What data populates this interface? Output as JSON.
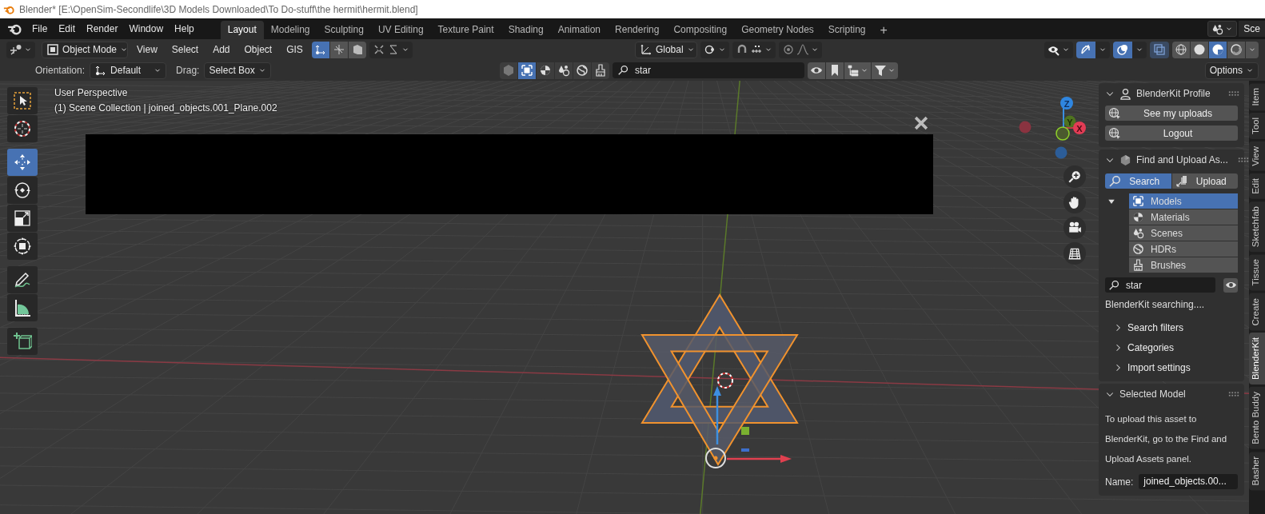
{
  "window": {
    "title": "Blender* [E:\\OpenSim-Secondlife\\3D Models Downloaded\\To Do-stuff\\the hermit\\hermit.blend]"
  },
  "menu": [
    "File",
    "Edit",
    "Render",
    "Window",
    "Help"
  ],
  "workspaces": [
    {
      "label": "Layout",
      "selected": true
    },
    {
      "label": "Modeling",
      "selected": false
    },
    {
      "label": "Sculpting",
      "selected": false
    },
    {
      "label": "UV Editing",
      "selected": false
    },
    {
      "label": "Texture Paint",
      "selected": false
    },
    {
      "label": "Shading",
      "selected": false
    },
    {
      "label": "Animation",
      "selected": false
    },
    {
      "label": "Rendering",
      "selected": false
    },
    {
      "label": "Compositing",
      "selected": false
    },
    {
      "label": "Geometry Nodes",
      "selected": false
    },
    {
      "label": "Scripting",
      "selected": false
    }
  ],
  "add_workspace": "+",
  "scene": {
    "label": "Sce"
  },
  "header": {
    "mode": "Object Mode",
    "menus": [
      "View",
      "Select",
      "Add",
      "Object",
      "GIS"
    ],
    "affect_toggles": [
      {
        "selected": true
      },
      {
        "selected": false
      },
      {
        "selected": false
      }
    ],
    "orientation": "Global",
    "gizmos_on": true,
    "overlays_on": true,
    "shading": [
      {
        "selected": false
      },
      {
        "selected": false
      },
      {
        "selected": true
      },
      {
        "selected": false
      }
    ]
  },
  "tool_settings": {
    "orientation_label": "Orientation:",
    "orientation": "Default",
    "drag_label": "Drag:",
    "drag": "Select Box",
    "asset_types": [
      {
        "kind": "any",
        "selected": false
      },
      {
        "kind": "model",
        "selected": true
      },
      {
        "kind": "material",
        "selected": false
      },
      {
        "kind": "scene",
        "selected": false
      },
      {
        "kind": "hdr",
        "selected": false
      },
      {
        "kind": "brush",
        "selected": false
      }
    ],
    "search": "star",
    "options": "Options"
  },
  "viewport": {
    "view_name": "User Perspective",
    "collection": "(1) Scene Collection | joined_objects.001_Plane.002",
    "tools": [
      {
        "kind": "select",
        "selected": false
      },
      {
        "kind": "cursor",
        "selected": false
      },
      {
        "kind": "move",
        "selected": true
      },
      {
        "kind": "rotate",
        "selected": false
      },
      {
        "kind": "scale",
        "selected": false
      },
      {
        "kind": "transform",
        "selected": false
      },
      {
        "kind": "annotate",
        "selected": false
      },
      {
        "kind": "measure",
        "selected": false
      },
      {
        "kind": "add-cube",
        "selected": false
      }
    ],
    "gizmo_axes": [
      "X",
      "Y",
      "Z"
    ]
  },
  "sidebar": {
    "profile": {
      "title": "BlenderKit Profile",
      "expanded": true,
      "buttons": [
        "See my uploads",
        "Logout"
      ]
    },
    "find": {
      "title": "Find and Upload As...",
      "expanded": true,
      "modes": [
        {
          "label": "Search",
          "selected": true
        },
        {
          "label": "Upload",
          "selected": false
        }
      ],
      "asset_types": [
        {
          "label": "Models",
          "kind": "model",
          "selected": true
        },
        {
          "label": "Materials",
          "kind": "material",
          "selected": false
        },
        {
          "label": "Scenes",
          "kind": "scene",
          "selected": false
        },
        {
          "label": "HDRs",
          "kind": "hdr",
          "selected": false
        },
        {
          "label": "Brushes",
          "kind": "brush",
          "selected": false
        }
      ],
      "search": "star",
      "status": "BlenderKit searching....",
      "subpanels": [
        {
          "label": "Search filters",
          "expanded": false
        },
        {
          "label": "Categories",
          "expanded": false
        },
        {
          "label": "Import settings",
          "expanded": false
        }
      ]
    },
    "selected_model": {
      "title": "Selected Model",
      "expanded": true,
      "text": "To upload this asset to BlenderKit, go to the Find and Upload Assets panel.",
      "name_label": "Name:",
      "name": "joined_objects.00..."
    }
  },
  "sidebar_tabs": [
    {
      "label": "Item",
      "selected": false
    },
    {
      "label": "Tool",
      "selected": false
    },
    {
      "label": "View",
      "selected": false
    },
    {
      "label": "Edit",
      "selected": false
    },
    {
      "label": "Sketchfab",
      "selected": false
    },
    {
      "label": "Tissue",
      "selected": false
    },
    {
      "label": "Create",
      "selected": false
    },
    {
      "label": "BlenderKit",
      "selected": true
    },
    {
      "label": "Bento Buddy",
      "selected": false
    },
    {
      "label": "Basher",
      "selected": false
    }
  ]
}
